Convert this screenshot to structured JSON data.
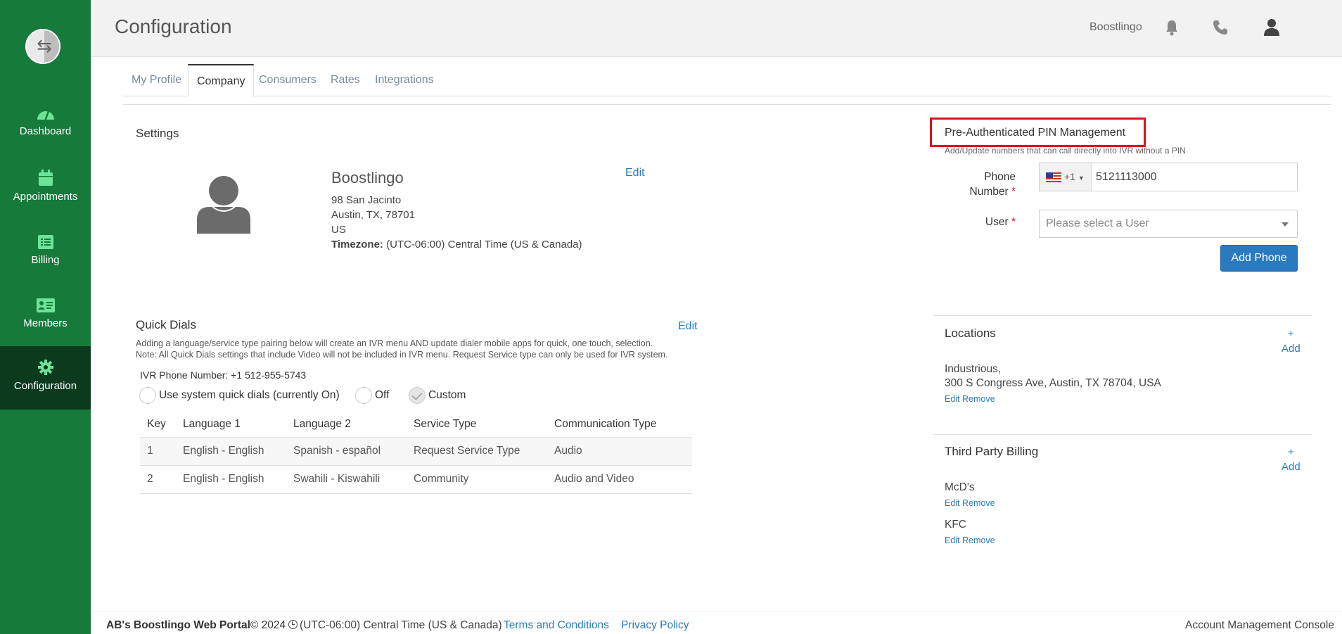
{
  "sidebar": {
    "items": [
      {
        "label": "Dashboard",
        "icon": "dashboard-icon"
      },
      {
        "label": "Appointments",
        "icon": "calendar-icon"
      },
      {
        "label": "Billing",
        "icon": "billing-icon"
      },
      {
        "label": "Members",
        "icon": "members-icon"
      },
      {
        "label": "Configuration",
        "icon": "gear-icon",
        "active": true
      }
    ]
  },
  "header": {
    "title": "Configuration",
    "user": "Boostlingo"
  },
  "tabs": [
    "My Profile",
    "Company",
    "Consumers",
    "Rates",
    "Integrations"
  ],
  "active_tab": "Company",
  "settings": {
    "title": "Settings",
    "edit": "Edit",
    "company_name": "Boostlingo",
    "address1": "98 San Jacinto",
    "address2": "Austin, TX, 78701",
    "country": "US",
    "timezone_label": "Timezone:",
    "timezone_value": " (UTC-06:00) Central Time (US & Canada)"
  },
  "quick_dials": {
    "title": "Quick Dials",
    "edit": "Edit",
    "desc1": "Adding a language/service type pairing below will create an IVR menu AND update dialer mobile apps for quick, one touch, selection.",
    "desc2": "Note: All Quick Dials settings that include Video will not be included in IVR menu. Request Service type can only be used for IVR system.",
    "ivr_number": "IVR Phone Number: +1 512-955-5743",
    "options": [
      "Use system quick dials (currently On)",
      "Off",
      "Custom"
    ],
    "selected_option": "Custom",
    "columns": [
      "Key",
      "Language 1",
      "Language 2",
      "Service Type",
      "Communication Type"
    ],
    "rows": [
      [
        "1",
        "English - English",
        "Spanish - español",
        "Request Service Type",
        "Audio"
      ],
      [
        "2",
        "English - English",
        "Swahili - Kiswahili",
        "Community",
        "Audio and Video"
      ]
    ]
  },
  "pin": {
    "title": "Pre-Authenticated PIN Management",
    "subtitle": "Add/Update numbers that can call directly into IVR without a PIN",
    "phone_label_1": "Phone",
    "phone_label_2": "Number",
    "country_code": "+1",
    "phone_value": "5121113000",
    "user_label": "User",
    "user_placeholder": "Please select a User",
    "required_mark": "*",
    "add_button": "Add Phone"
  },
  "locations": {
    "title": "Locations",
    "add_plus": "+",
    "add_label": "Add",
    "items": [
      {
        "name": "Industrious,",
        "address": "300 S Congress Ave, Austin, TX 78704, USA"
      }
    ],
    "edit": "Edit",
    "remove": "Remove"
  },
  "third_party_billing": {
    "title": "Third Party Billing",
    "add_plus": "+",
    "add_label": "Add",
    "items": [
      "McD's",
      "KFC"
    ],
    "edit": "Edit",
    "remove": "Remove"
  },
  "footer": {
    "brand": "AB's Boostlingo Web Portal",
    "copyright": "© 2024",
    "timezone": "(UTC-06:00) Central Time (US & Canada)",
    "terms": "Terms and Conditions",
    "privacy": "Privacy Policy",
    "console": "Account Management Console"
  },
  "colors": {
    "sidebar": "#167a3a",
    "sidebar_active": "#0b3a1d",
    "accent_icon": "#6fe39a",
    "link": "#2a7ac0",
    "highlight_box": "#d9141a"
  }
}
